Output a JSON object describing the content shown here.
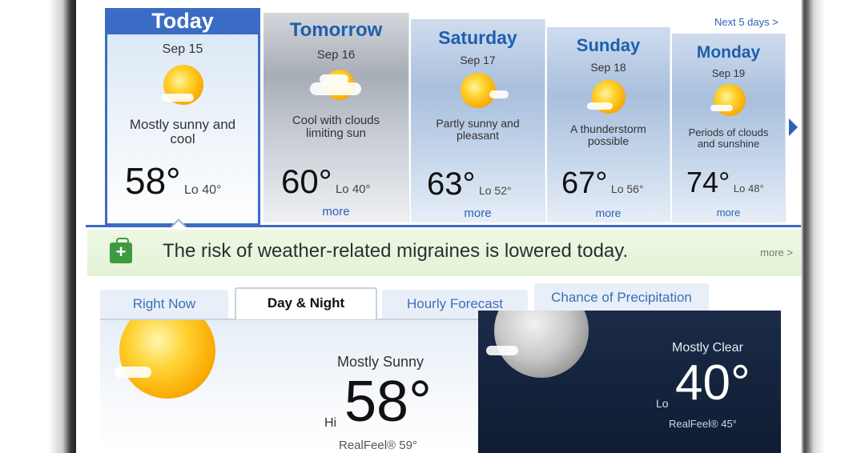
{
  "forecast": {
    "next_link": "Next 5 days >",
    "days": [
      {
        "name": "Today",
        "date": "Sep 15",
        "condition_line1": "Mostly sunny and",
        "condition_line2": "cool",
        "hi": "58°",
        "lo": "Lo 40°",
        "icon": "sun-icon"
      },
      {
        "name": "Tomorrow",
        "date": "Sep 16",
        "condition_line1": "Cool with clouds",
        "condition_line2": "limiting sun",
        "hi": "60°",
        "lo": "Lo 40°",
        "more": "more",
        "icon": "partly-cloudy-icon"
      },
      {
        "name": "Saturday",
        "date": "Sep 17",
        "condition_line1": "Partly sunny and",
        "condition_line2": "pleasant",
        "hi": "63°",
        "lo": "Lo 52°",
        "more": "more",
        "icon": "partly-sunny-icon"
      },
      {
        "name": "Sunday",
        "date": "Sep 18",
        "condition_line1": "A thunderstorm",
        "condition_line2": "possible",
        "hi": "67°",
        "lo": "Lo 56°",
        "more": "more",
        "icon": "partly-sunny-icon"
      },
      {
        "name": "Monday",
        "date": "Sep 19",
        "condition_line1": "Periods of clouds",
        "condition_line2": "and sunshine",
        "hi": "74°",
        "lo": "Lo 48°",
        "more": "more",
        "icon": "partly-sunny-icon"
      }
    ]
  },
  "banner": {
    "message": "The risk of weather-related migraines is lowered today.",
    "more": "more >",
    "icon": "shopping-bag-plus-icon"
  },
  "tabs": [
    {
      "label": "Right Now"
    },
    {
      "label": "Day & Night",
      "active": true
    },
    {
      "label": "Hourly Forecast"
    },
    {
      "label": "Chance of Precipitation"
    }
  ],
  "day_panel": {
    "condition": "Mostly Sunny",
    "hi_label": "Hi",
    "temp": "58°",
    "realfeel": "RealFeel® 59°"
  },
  "night_panel": {
    "condition": "Mostly Clear",
    "lo_label": "Lo",
    "temp": "40°",
    "realfeel": "RealFeel® 45°"
  },
  "colors": {
    "accent_blue": "#3b6cc5",
    "link_blue": "#2a62b8",
    "banner_green": "#e3f2d6",
    "icon_green": "#3d9b3f",
    "night_bg": "#15233d"
  }
}
